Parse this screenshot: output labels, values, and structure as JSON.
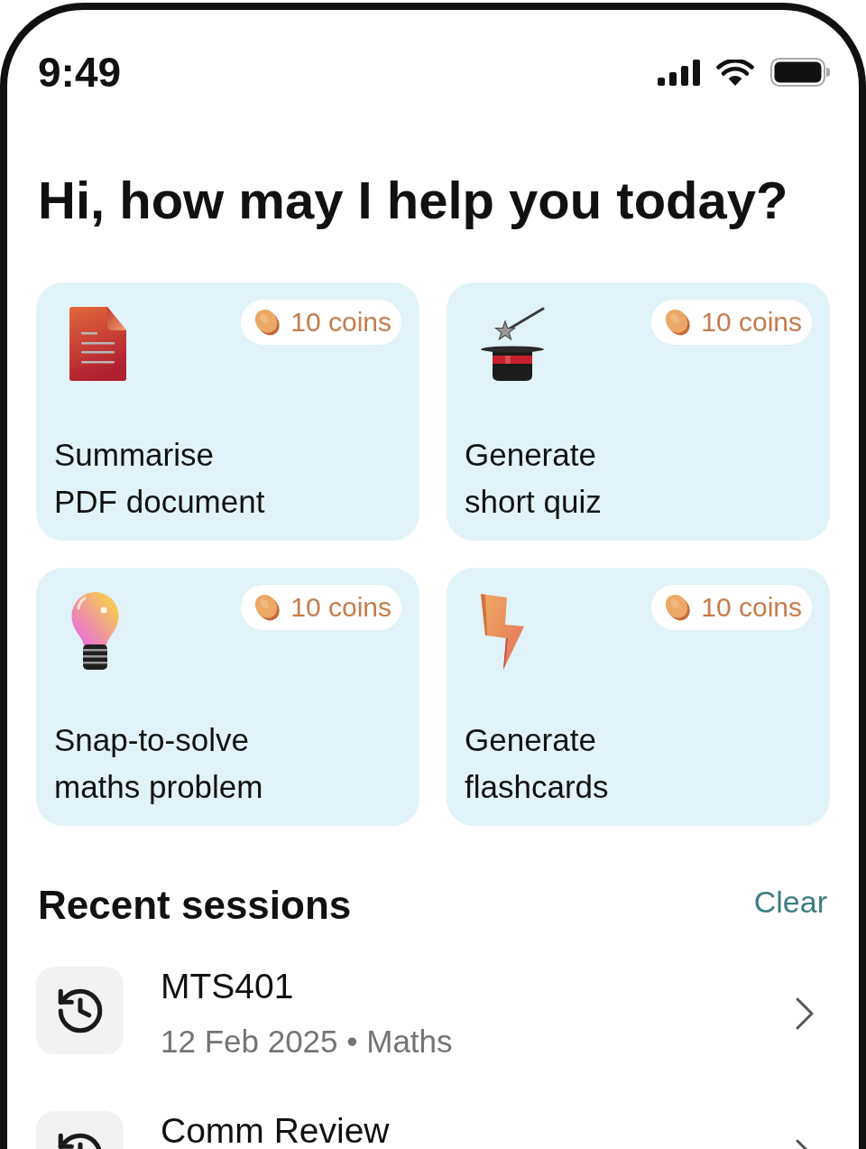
{
  "status_bar": {
    "time": "9:49"
  },
  "greeting": "Hi, how may I help you today?",
  "actions": [
    {
      "kind": "document",
      "cost": "10 coins",
      "title": "Summarise\nPDF document"
    },
    {
      "kind": "magic-hat",
      "cost": "10 coins",
      "title": "Generate\nshort quiz"
    },
    {
      "kind": "lightbulb",
      "cost": "10 coins",
      "title": "Snap-to-solve\nmaths problem"
    },
    {
      "kind": "lightning",
      "cost": "10 coins",
      "title": "Generate\nflashcards"
    }
  ],
  "recent_sessions": {
    "title": "Recent sessions",
    "clear_label": "Clear",
    "items": [
      {
        "title": "MTS401",
        "meta": "12 Feb 2025 • Maths"
      },
      {
        "title": "Comm Review"
      }
    ]
  }
}
